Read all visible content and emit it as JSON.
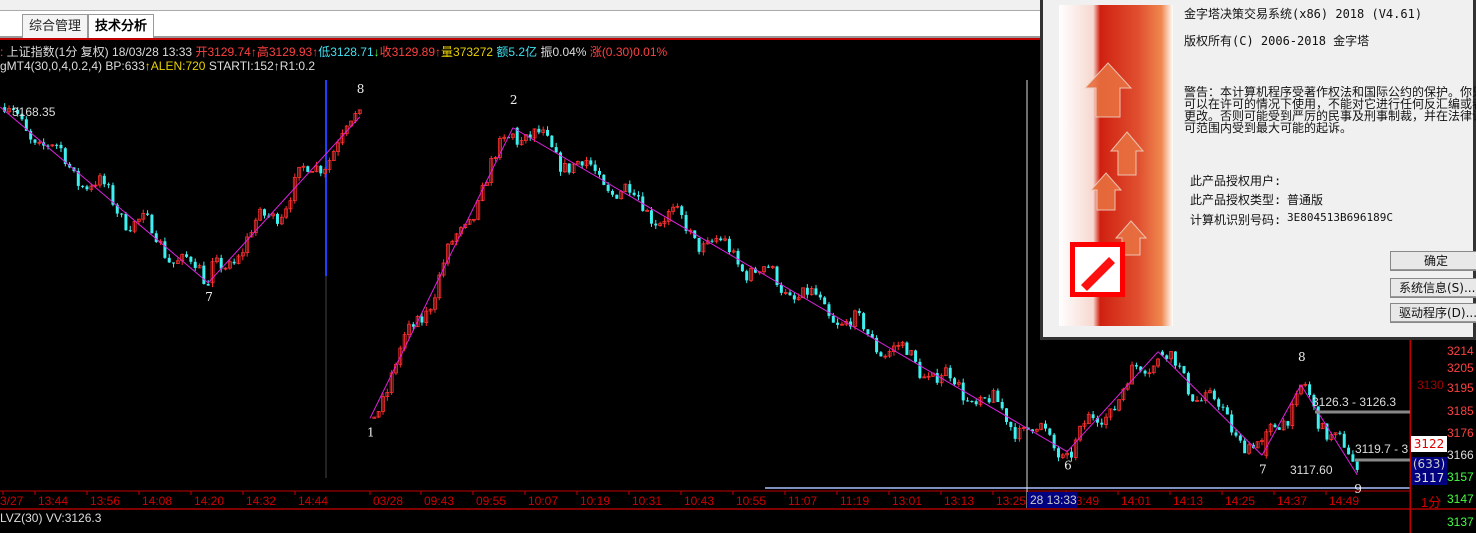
{
  "tabs": [
    {
      "label": "综合管理"
    },
    {
      "label": "技术分析"
    }
  ],
  "quote": {
    "name": "上证指数(1分 复权)",
    "datetime": "18/03/28 13:33",
    "open": "开3129.74",
    "high": "高3129.93",
    "low": "低3128.71",
    "close": "收3129.89",
    "volume": "量373272",
    "amount": "额5.2亿",
    "amplitude": "振0.04%",
    "change": "涨(0.30)0.01%"
  },
  "indicator": {
    "name": "gMT4(30,0,4,0.2,4)",
    "bp": "BP:633",
    "alen": "ALEN:720",
    "starti": "STARTI:152",
    "r1": "R1:0.2"
  },
  "sub_indicator": {
    "name": "LVZ(30)",
    "value": "VV:3126.3"
  },
  "chart_data": {
    "type": "candlestick",
    "interval": "1分",
    "price_label_top_left": "3168.35",
    "waves": [
      {
        "label": "",
        "time": "03/27 13:36",
        "price": 3168.35
      },
      {
        "label": "7",
        "time": "03/27 14:24",
        "price": 3144.1
      },
      {
        "label": "8",
        "time": "03/27 14:59",
        "price": 3167.0
      },
      {
        "label": "1",
        "time": "03/28 09:31",
        "price": 3125.4
      },
      {
        "label": "2",
        "time": "03/28 10:04",
        "price": 3165.5
      },
      {
        "label": "6",
        "time": "03/28 13:41",
        "price": 3120.8
      },
      {
        "label": "",
        "time": "03/28 14:02",
        "price": 3134.6
      },
      {
        "label": "7",
        "time": "03/28 14:26",
        "price": 3120.3
      },
      {
        "label": "8",
        "time": "03/28 14:35",
        "price": 3130.0
      },
      {
        "label": "9",
        "time": "03/28 14:48",
        "price": 3117.6
      }
    ],
    "annotations": [
      "3126.3 - 3126.3",
      "3119.7 - 3",
      "3117.60"
    ],
    "x_ticks": [
      "3/27",
      "13:44",
      "13:56",
      "14:08",
      "14:20",
      "14:32",
      "14:44",
      "03/28",
      "09:43",
      "09:55",
      "10:07",
      "10:19",
      "10:31",
      "10:43",
      "10:55",
      "11:07",
      "11:19",
      "13:01",
      "13:13",
      "13:25",
      "13:49",
      "14:01",
      "14:13",
      "14:25",
      "14:37",
      "14:49"
    ],
    "cursor_time": "28 13:33",
    "y_tick": "3130",
    "current_price_tag": "3122",
    "bp_tag": "(633)",
    "low_tag": "3117",
    "colors": {
      "up": "#ff3030",
      "down": "#40f0f0",
      "wave": "#e020e0",
      "axis": "#d00000"
    }
  },
  "right_axis": {
    "values": [
      "3214",
      "3205",
      "3195",
      "3185",
      "3176",
      "3166",
      "3157",
      "3147",
      "3137"
    ]
  },
  "dialog": {
    "title": "金字塔决策交易系统(x86) 2018 (V4.61)",
    "copyright": "版权所有(C) 2006-2018 金字塔",
    "warning": [
      "警告：本计算机程序受著作权法和国际公约的保护。你只",
      "可以在许可的情况下使用，不能对它进行任何反汇编或者",
      "更改。否则可能受到严厉的民事及刑事制裁，并在法律许",
      "可范围内受到最大可能的起诉。"
    ],
    "user_label": "此产品授权用户:",
    "type_label": "此产品授权类型:",
    "type_value": "普通版",
    "machine_label": "计算机识别号码:",
    "machine_value": "3E804513B696189C",
    "ok": "确定",
    "sysinfo": "系统信息(S)...",
    "driver": "驱动程序(D)..."
  }
}
